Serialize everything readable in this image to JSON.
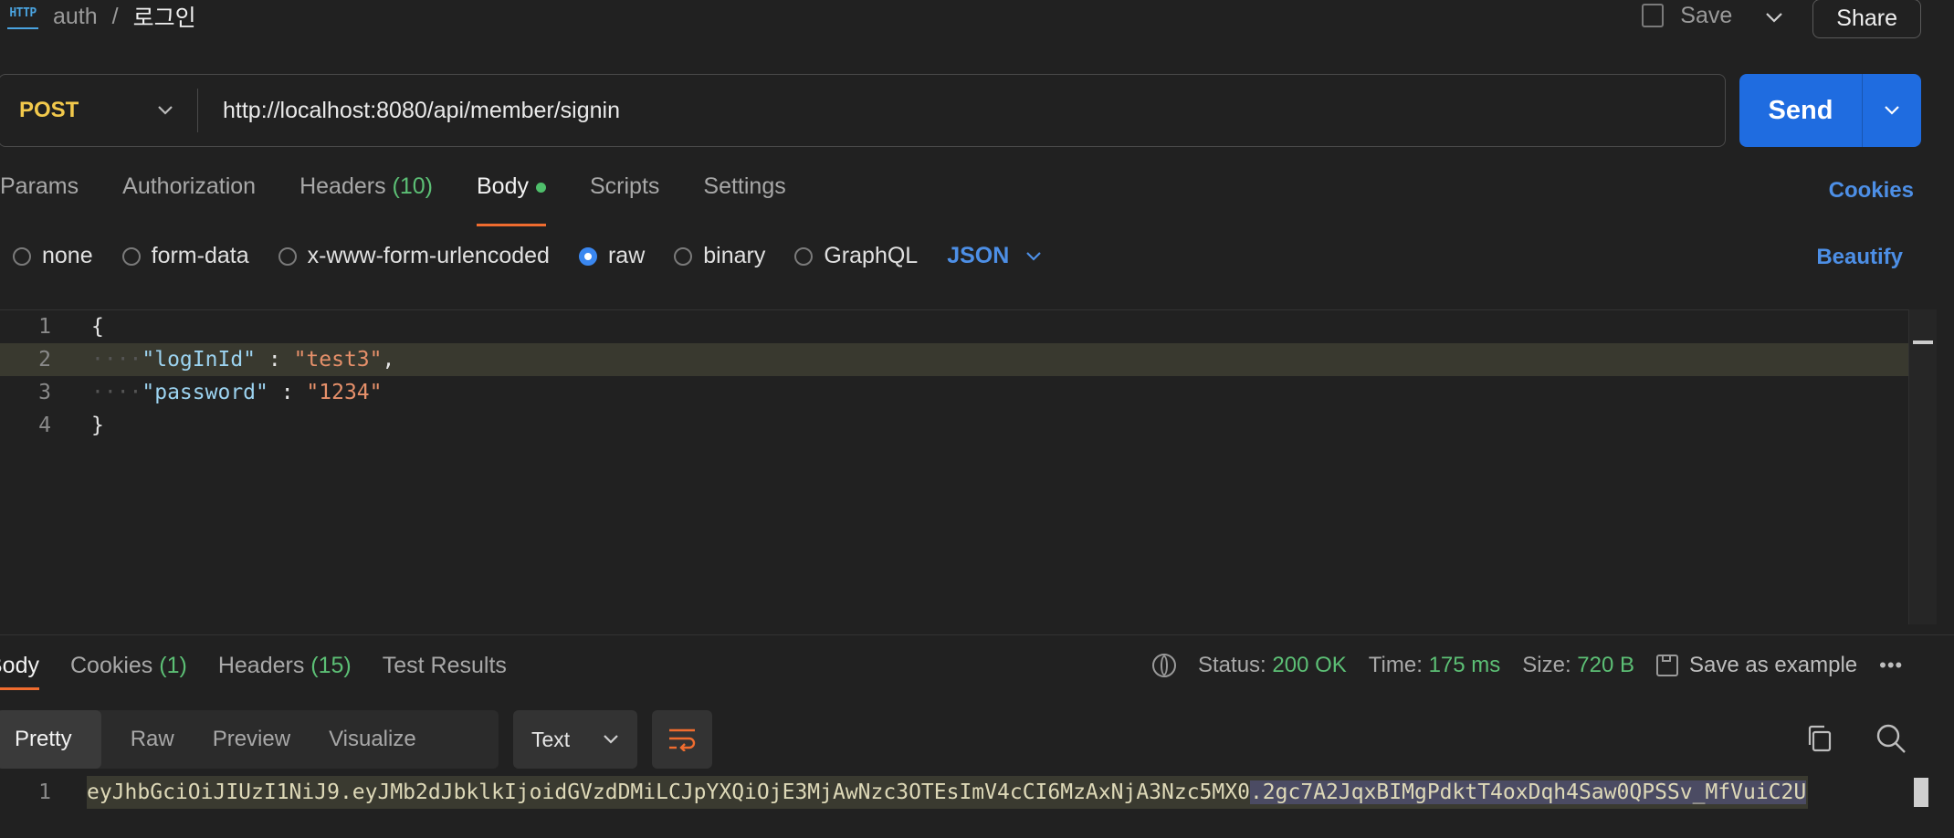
{
  "header": {
    "icon_text": "HTTP",
    "breadcrumb_parent": "auth",
    "breadcrumb_sep": "/",
    "request_name": "로그인",
    "save_label": "Save",
    "share_label": "Share"
  },
  "request": {
    "method": "POST",
    "url": "http://localhost:8080/api/member/signin",
    "send_label": "Send"
  },
  "tabs": {
    "params": "Params",
    "authorization": "Authorization",
    "headers": "Headers",
    "headers_count": "(10)",
    "body": "Body",
    "scripts": "Scripts",
    "settings": "Settings",
    "cookies": "Cookies"
  },
  "body_options": {
    "none": "none",
    "form_data": "form-data",
    "urlencoded": "x-www-form-urlencoded",
    "raw": "raw",
    "binary": "binary",
    "graphql": "GraphQL",
    "language": "JSON",
    "selected": "raw",
    "beautify": "Beautify"
  },
  "editor": {
    "lines": [
      {
        "num": "1",
        "text": "{"
      },
      {
        "num": "2",
        "key": "\"logInId\"",
        "sep": " : ",
        "value": "\"test3\"",
        "tail": ","
      },
      {
        "num": "3",
        "key": "\"password\"",
        "sep": " : ",
        "value": "\"1234\"",
        "tail": ""
      },
      {
        "num": "4",
        "text": "}"
      }
    ]
  },
  "response": {
    "tabs": {
      "body": "Body",
      "cookies": "Cookies",
      "cookies_count": "(1)",
      "headers": "Headers",
      "headers_count": "(15)",
      "test_results": "Test Results"
    },
    "status_label": "Status:",
    "status_value": "200 OK",
    "time_label": "Time:",
    "time_value": "175 ms",
    "size_label": "Size:",
    "size_value": "720 B",
    "save_example": "Save as example",
    "more": "•••",
    "views": {
      "pretty": "Pretty",
      "raw": "Raw",
      "preview": "Preview",
      "visualize": "Visualize"
    },
    "format": "Text",
    "line_num": "1",
    "token_part1": "eyJhbGciOiJIUzI1NiJ9.eyJMb2dJbklkIjoidGVzdDMiLCJpYXQiOjE3MjAwNzc3OTEsImV4cCI6MzAxNjA3Nzc5MX0",
    "token_part2": ".2gc7A2JqxBIMgPdktT4oxDqh4Saw0QPSSv_MfVuiC2U"
  },
  "colors": {
    "accent": "#ef6c2f",
    "send": "#1f6ce0",
    "link": "#4d8fe6",
    "method": "#f2c94c",
    "ok": "#5cbf75"
  }
}
